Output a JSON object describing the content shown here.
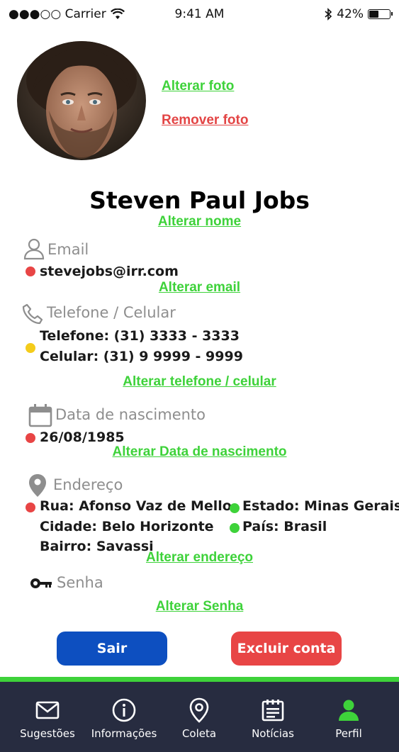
{
  "status_bar": {
    "carrier": "●●●○○ Carrier",
    "time": "9:41 AM",
    "battery": "42%"
  },
  "profile": {
    "change_photo": "Alterar foto",
    "remove_photo": "Remover foto",
    "name": "Steven Paul Jobs",
    "change_name": "Alterar nome"
  },
  "email": {
    "label": "Email",
    "value": "stevejobs@irr.com",
    "change": "Alterar email"
  },
  "phone": {
    "label": "Telefone / Celular",
    "telefone": "Telefone: (31) 3333 - 3333",
    "celular": "Celular: (31) 9 9999 - 9999",
    "change": "Alterar telefone / celular"
  },
  "birth": {
    "label": "Data de nascimento",
    "value": "26/08/1985",
    "change": "Alterar Data de nascimento"
  },
  "address": {
    "label": "Endereço",
    "rua": "Rua: Afonso Vaz de Mello",
    "cidade": "Cidade: Belo Horizonte",
    "bairro": "Bairro: Savassi",
    "estado": "Estado: Minas Gerais",
    "pais": "País: Brasil",
    "change": "Alterar endereço"
  },
  "password": {
    "label": "Senha",
    "change": "Alterar Senha"
  },
  "actions": {
    "logout": "Sair",
    "delete": "Excluir conta"
  },
  "tabs": [
    {
      "label": "Sugestões",
      "icon": "envelope-icon"
    },
    {
      "label": "Informações",
      "icon": "info-icon"
    },
    {
      "label": "Coleta",
      "icon": "location-pin-icon"
    },
    {
      "label": "Notícias",
      "icon": "news-icon"
    },
    {
      "label": "Perfil",
      "icon": "person-icon",
      "active": true
    }
  ],
  "colors": {
    "link_green": "#3ed23a",
    "link_red": "#e34545",
    "status_red": "#e84545",
    "status_yellow": "#f4cc1b",
    "status_green": "#3ed23a",
    "primary_blue": "#0d4fc0",
    "danger_red": "#e84545",
    "tabbar_bg": "#272c40"
  }
}
